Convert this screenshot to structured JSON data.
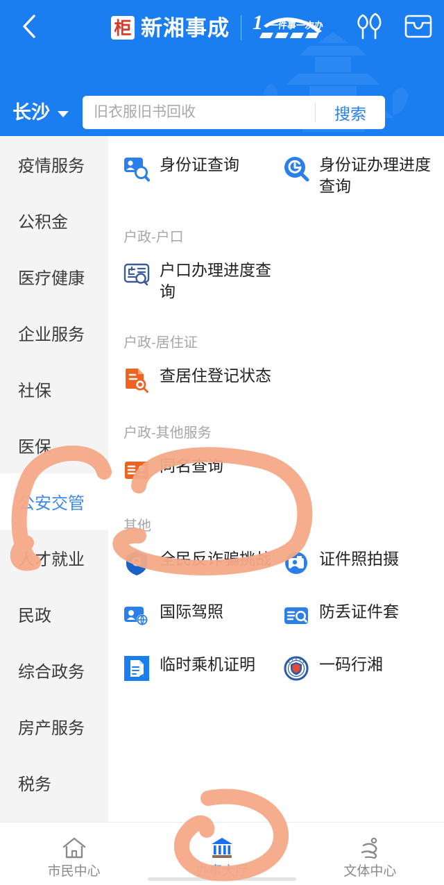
{
  "header": {
    "back_icon": "chevron-left-icon",
    "brand_stamp_char": "柜",
    "brand_title": "新湘事成",
    "slogan_number": "1",
    "slogan_text": "一件事一次办",
    "icons": [
      {
        "name": "park-tree-icon"
      },
      {
        "name": "wallet-card-icon"
      }
    ]
  },
  "search": {
    "city": "长沙",
    "city_caret_icon": "caret-down-icon",
    "placeholder": "旧衣服旧书回收",
    "value": "",
    "button_label": "搜索"
  },
  "sidebar": {
    "items": [
      {
        "label": "疫情服务",
        "active": false
      },
      {
        "label": "公积金",
        "active": false
      },
      {
        "label": "医疗健康",
        "active": false
      },
      {
        "label": "企业服务",
        "active": false
      },
      {
        "label": "社保",
        "active": false
      },
      {
        "label": "医保",
        "active": false
      },
      {
        "label": "公安交管",
        "active": true
      },
      {
        "label": "人才就业",
        "active": false
      },
      {
        "label": "民政",
        "active": false
      },
      {
        "label": "综合政务",
        "active": false
      },
      {
        "label": "房产服务",
        "active": false
      },
      {
        "label": "税务",
        "active": false
      }
    ]
  },
  "panel": {
    "sections": [
      {
        "title": "",
        "items": [
          {
            "label": "身份证查询",
            "icon": "id-card-search-icon",
            "color": "#2b7fe8"
          },
          {
            "label": "身份证办理进度查询",
            "icon": "progress-search-icon",
            "color": "#2b7fe8"
          }
        ]
      },
      {
        "title": "户政-户口",
        "items": [
          {
            "label": "户口办理进度查询",
            "icon": "household-book-search-icon",
            "color": "#3b5a98"
          }
        ]
      },
      {
        "title": "户政-居住证",
        "items": [
          {
            "label": "查居住登记状态",
            "icon": "document-search-icon",
            "color": "#ec6422"
          }
        ]
      },
      {
        "title": "户政-其他服务",
        "items": [
          {
            "label": "同名查询",
            "icon": "name-card-icon",
            "color": "#ec6422"
          }
        ]
      },
      {
        "title": "其他",
        "items": [
          {
            "label": "全民反诈骗挑战",
            "icon": "shield-police-icon",
            "color": "#1a61c9"
          },
          {
            "label": "证件照拍摄",
            "icon": "photo-camera-person-icon",
            "color": "#2b7fe8"
          },
          {
            "label": "国际驾照",
            "icon": "driver-license-globe-icon",
            "color": "#2b7fe8"
          },
          {
            "label": "防丢证件套",
            "icon": "card-holder-search-icon",
            "color": "#2b7fe8"
          },
          {
            "label": "临时乘机证明",
            "icon": "boarding-certificate-icon",
            "color": "#1a7df0"
          },
          {
            "label": "一码行湘",
            "icon": "police-badge-icon",
            "color": "#2b5ca8"
          }
        ]
      }
    ]
  },
  "tabbar": {
    "tabs": [
      {
        "label": "市民中心",
        "icon": "home-icon",
        "active": false
      },
      {
        "label": "办事大厅",
        "icon": "bank-hall-icon",
        "active": true
      },
      {
        "label": "文体中心",
        "icon": "running-person-icon",
        "active": false
      }
    ]
  },
  "annotations": {
    "color": "#f4a987",
    "marks": [
      {
        "name": "circle-around-gongan-jiaoguan",
        "target": "公安交管"
      },
      {
        "name": "circle-around-tongming-chaxun",
        "target": "同名查询"
      },
      {
        "name": "circle-around-banshi-datang",
        "target": "办事大厅"
      }
    ]
  }
}
